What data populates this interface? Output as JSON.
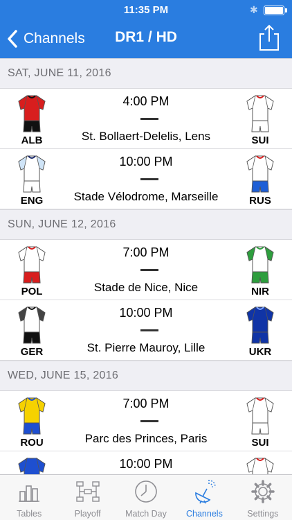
{
  "status_bar": {
    "time": "11:35 PM"
  },
  "nav": {
    "back_label": "Channels",
    "title": "DR1 / HD"
  },
  "sections": [
    {
      "date": "SAT, JUNE 11, 2016",
      "matches": [
        {
          "time": "4:00 PM",
          "venue": "St. Bollaert-Delelis, Lens",
          "home": {
            "code": "ALB",
            "shirt": "#d81e1e",
            "sleeve": "#d81e1e",
            "shorts": "#111111",
            "trim": "#111111"
          },
          "away": {
            "code": "SUI",
            "shirt": "#ffffff",
            "sleeve": "#ffffff",
            "shorts": "#ffffff",
            "trim": "#d81e1e"
          }
        },
        {
          "time": "10:00 PM",
          "venue": "Stade Vélodrome, Marseille",
          "home": {
            "code": "ENG",
            "shirt": "#ffffff",
            "sleeve": "#cfe4f7",
            "shorts": "#ffffff",
            "trim": "#1a2a6c"
          },
          "away": {
            "code": "RUS",
            "shirt": "#ffffff",
            "sleeve": "#ffffff",
            "shorts": "#1e5fd6",
            "trim": "#d81e1e"
          }
        }
      ]
    },
    {
      "date": "SUN, JUNE 12, 2016",
      "matches": [
        {
          "time": "7:00 PM",
          "venue": "Stade de Nice, Nice",
          "home": {
            "code": "POL",
            "shirt": "#ffffff",
            "sleeve": "#ffffff",
            "shorts": "#d81e1e",
            "trim": "#d81e1e"
          },
          "away": {
            "code": "NIR",
            "shirt": "#ffffff",
            "sleeve": "#2e9e3e",
            "shorts": "#2e9e3e",
            "trim": "#2e9e3e"
          }
        },
        {
          "time": "10:00 PM",
          "venue": "St. Pierre Mauroy, Lille",
          "home": {
            "code": "GER",
            "shirt": "#ffffff",
            "sleeve": "#444444",
            "shorts": "#111111",
            "trim": "#111111"
          },
          "away": {
            "code": "UKR",
            "shirt": "#1034a6",
            "sleeve": "#1034a6",
            "shorts": "#1034a6",
            "trim": "#7fa6ff"
          }
        }
      ]
    },
    {
      "date": "WED, JUNE 15, 2016",
      "matches": [
        {
          "time": "7:00 PM",
          "venue": "Parc des Princes, Paris",
          "home": {
            "code": "ROU",
            "shirt": "#f6d200",
            "sleeve": "#f6d200",
            "shorts": "#1e4fd0",
            "trim": "#1e4fd0"
          },
          "away": {
            "code": "SUI",
            "shirt": "#ffffff",
            "sleeve": "#ffffff",
            "shorts": "#ffffff",
            "trim": "#d81e1e"
          }
        },
        {
          "time": "10:00 PM",
          "venue": "",
          "home": {
            "code": "",
            "shirt": "#1e4fd0",
            "sleeve": "#1e4fd0",
            "shorts": "#1e4fd0",
            "trim": "#1e4fd0"
          },
          "away": {
            "code": "",
            "shirt": "#ffffff",
            "sleeve": "#ffffff",
            "shorts": "#ffffff",
            "trim": "#d81e1e"
          }
        }
      ]
    }
  ],
  "tabs": [
    {
      "label": "Tables",
      "icon": "tables-icon",
      "active": false
    },
    {
      "label": "Playoff",
      "icon": "playoff-icon",
      "active": false
    },
    {
      "label": "Match Day",
      "icon": "match-day-icon",
      "active": false
    },
    {
      "label": "Channels",
      "icon": "channels-icon",
      "active": true
    },
    {
      "label": "Settings",
      "icon": "settings-icon",
      "active": false
    }
  ],
  "colors": {
    "accent": "#2a7de0",
    "inactive": "#8e8e93",
    "section_bg": "#efeff4"
  }
}
